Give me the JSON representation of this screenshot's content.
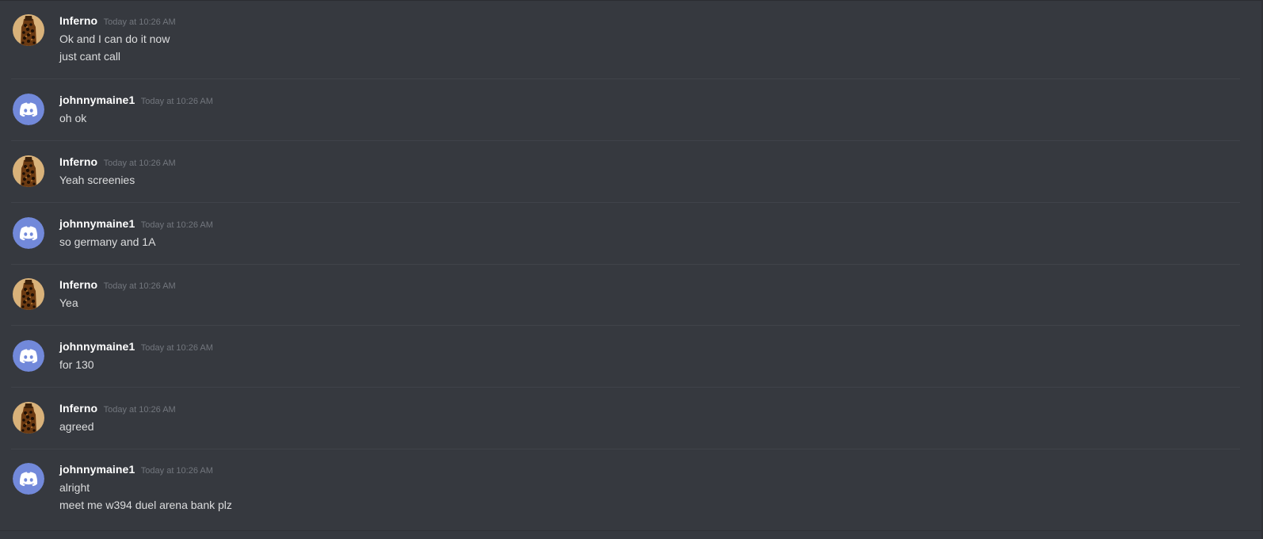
{
  "colors": {
    "background": "#36393f",
    "username": "#ffffff",
    "timestamp": "#72767d",
    "message_text": "#dcddde",
    "divider": "#40434a",
    "discord_blurple": "#7289da"
  },
  "messages": [
    {
      "author": "Inferno",
      "avatar": "leopard-avatar-icon",
      "timestamp": "Today at 10:26 AM",
      "lines": [
        "Ok and I can do it now",
        "just cant call"
      ]
    },
    {
      "author": "johnnymaine1",
      "avatar": "discord-default-avatar-icon",
      "timestamp": "Today at 10:26 AM",
      "lines": [
        "oh ok"
      ]
    },
    {
      "author": "Inferno",
      "avatar": "leopard-avatar-icon",
      "timestamp": "Today at 10:26 AM",
      "lines": [
        "Yeah screenies"
      ]
    },
    {
      "author": "johnnymaine1",
      "avatar": "discord-default-avatar-icon",
      "timestamp": "Today at 10:26 AM",
      "lines": [
        "so germany and 1A"
      ]
    },
    {
      "author": "Inferno",
      "avatar": "leopard-avatar-icon",
      "timestamp": "Today at 10:26 AM",
      "lines": [
        "Yea"
      ]
    },
    {
      "author": "johnnymaine1",
      "avatar": "discord-default-avatar-icon",
      "timestamp": "Today at 10:26 AM",
      "lines": [
        "for 130"
      ]
    },
    {
      "author": "Inferno",
      "avatar": "leopard-avatar-icon",
      "timestamp": "Today at 10:26 AM",
      "lines": [
        "agreed"
      ]
    },
    {
      "author": "johnnymaine1",
      "avatar": "discord-default-avatar-icon",
      "timestamp": "Today at 10:26 AM",
      "lines": [
        "alright",
        "meet me w394 duel arena bank plz"
      ]
    }
  ]
}
